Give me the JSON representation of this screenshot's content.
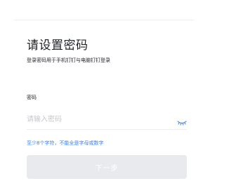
{
  "title": "请设置密码",
  "subtitle": "登录密码用于手机钉钉与电脑钉钉登录",
  "password": {
    "label": "密码",
    "placeholder": "请输入密码",
    "value": "",
    "visibility_icon": "eye-closed-icon"
  },
  "hint": "至少8个字符，不能全是字母或数字",
  "next_button": {
    "label": "下一步",
    "enabled": false
  },
  "colors": {
    "title": "#1f2329",
    "hint": "#3a7ef6",
    "accent": "#3a7ef6",
    "button_disabled_bg": "#e8eaed",
    "placeholder": "#c5c8cd"
  }
}
